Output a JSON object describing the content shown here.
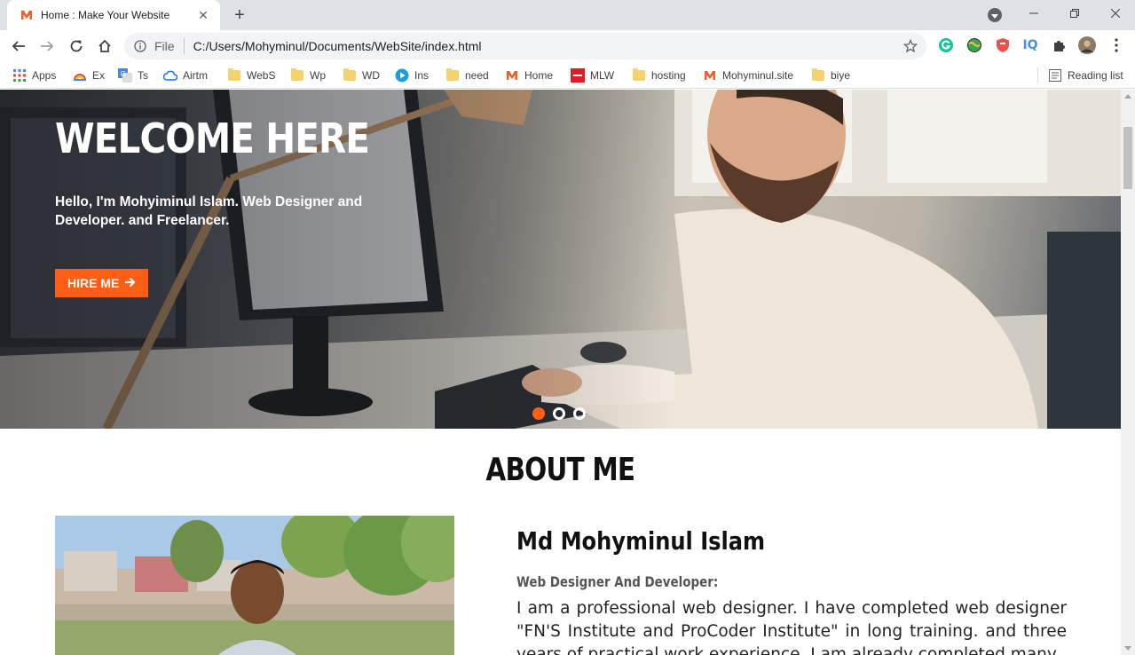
{
  "browser": {
    "tab": {
      "title": "Home : Make Your Website",
      "favicon": "mw-logo-icon"
    },
    "address": {
      "scheme_label": "File",
      "url": "C:/Users/Mohyminul/Documents/WebSite/index.html"
    },
    "bookmarks": [
      {
        "label": "Apps",
        "icon": "apps-grid-icon"
      },
      {
        "label": "Ex",
        "icon": "rainbow-icon"
      },
      {
        "label": "Ts",
        "icon": "translate-icon"
      },
      {
        "label": "Airtm",
        "icon": "cloud-icon"
      },
      {
        "label": "WebS",
        "icon": "folder-icon"
      },
      {
        "label": "Wp",
        "icon": "folder-icon"
      },
      {
        "label": "WD",
        "icon": "folder-icon"
      },
      {
        "label": "Ins",
        "icon": "play-circle-icon"
      },
      {
        "label": "need",
        "icon": "folder-icon"
      },
      {
        "label": "Home",
        "icon": "mw-logo-icon"
      },
      {
        "label": "MLW",
        "icon": "red-square-icon"
      },
      {
        "label": "hosting",
        "icon": "folder-icon"
      },
      {
        "label": "Mohyminul.site",
        "icon": "mw-logo-icon"
      },
      {
        "label": "biye",
        "icon": "folder-icon"
      }
    ],
    "reading_list": "Reading list"
  },
  "hero": {
    "title": "WELCOME HERE",
    "subtitle": "Hello, I'm Mohyiminul Islam. Web Designer and Developer. and Freelancer.",
    "button_label": "HIRE ME",
    "slides": 3,
    "active_slide": 1
  },
  "about": {
    "section_title": "ABOUT ME",
    "name": "Md Mohyminul Islam",
    "role": "Web Designer And Developer:",
    "text": "I am a professional web designer. I have completed web designer \"FN'S Institute and ProCoder Institute\" in long training. and three years of practical work experience. I am already completed many"
  },
  "colors": {
    "accent": "#ff5e14",
    "chrome_bg": "#dee1e6",
    "omnibox_bg": "#f1f3f4"
  }
}
